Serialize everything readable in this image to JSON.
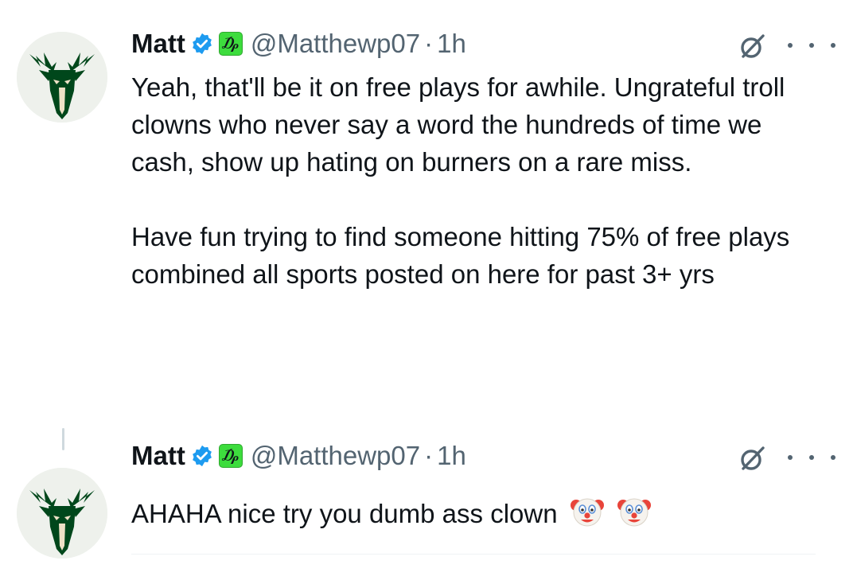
{
  "tweets": [
    {
      "author": {
        "name": "Matt",
        "handle": "@Matthewp07",
        "separator": "·",
        "time": "1h",
        "affiliate_badge": "₯"
      },
      "text_paragraphs": [
        "Yeah, that'll be it on free plays for awhile. Ungrateful troll clowns who never say a word the hundreds of time we cash, show up hating on burners on a rare miss.",
        "Have fun trying to find someone hitting 75% of free plays combined all sports posted on here for past 3+ yrs"
      ]
    },
    {
      "author": {
        "name": "Matt",
        "handle": "@Matthewp07",
        "separator": "·",
        "time": "1h",
        "affiliate_badge": "₯"
      },
      "text": "AHAHA nice try you dumb ass clown",
      "emojis": [
        "clown-face",
        "clown-face"
      ]
    }
  ],
  "icons": {
    "verified": "verified-badge-icon",
    "grok": "grok-icon",
    "more": "more-options-icon"
  },
  "colors": {
    "verified_blue": "#1d9bf0",
    "affiliate_green": "#3ddc3d",
    "avatar_green": "#00471b",
    "avatar_cream": "#eee1c6",
    "secondary_text": "#536471"
  }
}
